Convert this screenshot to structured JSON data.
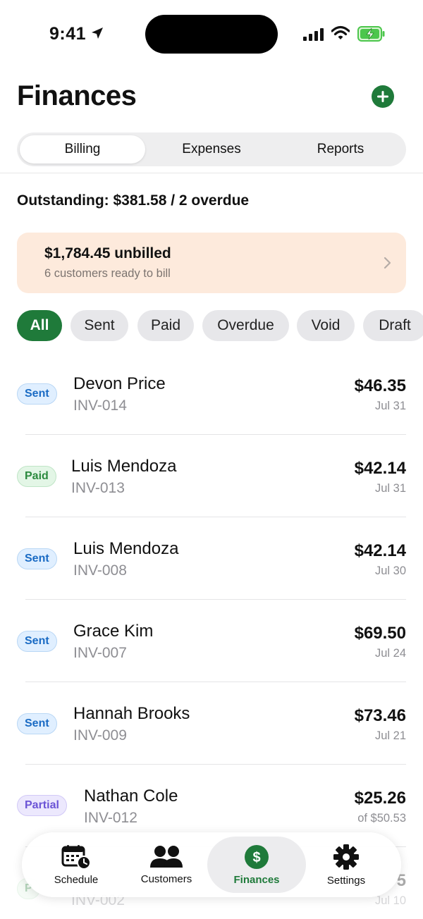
{
  "status_bar": {
    "time": "9:41"
  },
  "header": {
    "title": "Finances"
  },
  "segments": [
    "Billing",
    "Expenses",
    "Reports"
  ],
  "outstanding": "Outstanding: $381.58 / 2 overdue",
  "unbilled": {
    "amount": "$1,784.45 unbilled",
    "subtitle": "6 customers ready to bill"
  },
  "filters": [
    "All",
    "Sent",
    "Paid",
    "Overdue",
    "Void",
    "Draft"
  ],
  "invoices": [
    {
      "status": "Sent",
      "name": "Devon Price",
      "number": "INV-014",
      "amount": "$46.35",
      "date": "Jul 31"
    },
    {
      "status": "Paid",
      "name": "Luis Mendoza",
      "number": "INV-013",
      "amount": "$42.14",
      "date": "Jul 31"
    },
    {
      "status": "Sent",
      "name": "Luis Mendoza",
      "number": "INV-008",
      "amount": "$42.14",
      "date": "Jul 30"
    },
    {
      "status": "Sent",
      "name": "Grace Kim",
      "number": "INV-007",
      "amount": "$69.50",
      "date": "Jul 24"
    },
    {
      "status": "Sent",
      "name": "Hannah Brooks",
      "number": "INV-009",
      "amount": "$73.46",
      "date": "Jul 21"
    },
    {
      "status": "Partial",
      "name": "Nathan Cole",
      "number": "INV-012",
      "amount": "$25.26",
      "date": "of $50.53"
    },
    {
      "status": "P",
      "name": "",
      "number": "INV-002",
      "amount": "5",
      "date": "Jul 10"
    }
  ],
  "tabs": [
    "Schedule",
    "Customers",
    "Finances",
    "Settings"
  ],
  "colors": {
    "accent": "#1f7a3a",
    "card": "#fdeadc",
    "sent": "#1a6bc4",
    "paid": "#2b8a3e",
    "partial": "#6b54d6"
  },
  "icons": [
    "location-arrow-icon",
    "signal-icon",
    "wifi-icon",
    "battery-charging-icon",
    "plus-icon",
    "chevron-right-icon",
    "calendar-clock-icon",
    "users-icon",
    "dollar-icon",
    "gear-icon"
  ]
}
